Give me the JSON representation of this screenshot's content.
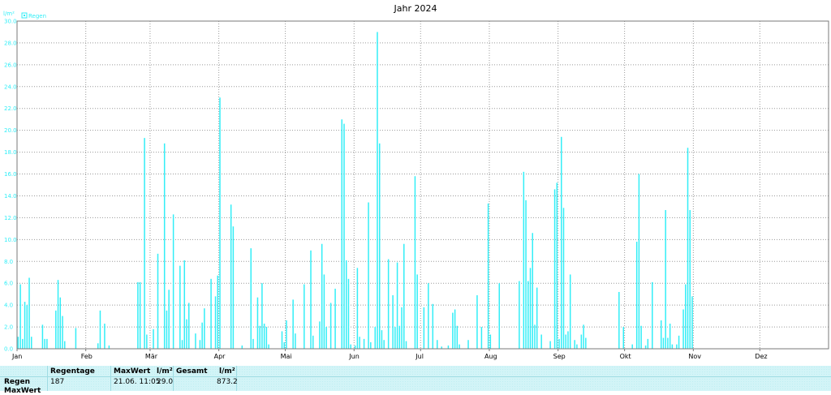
{
  "chart_data": {
    "type": "bar",
    "title": "Jahr 2024",
    "ylabel": "l/m²",
    "legend": [
      "Regen"
    ],
    "legend_position": "top-left",
    "series_color": "#33eef7",
    "grid": true,
    "ylim": [
      0,
      30
    ],
    "yticks": [
      "0.0",
      "2.0",
      "4.0",
      "6.0",
      "8.0",
      "10.0",
      "12.0",
      "14.0",
      "16.0",
      "18.0",
      "20.0",
      "22.0",
      "24.0",
      "26.0",
      "28.0",
      "30.0"
    ],
    "months": [
      "Jan",
      "Feb",
      "Mär",
      "Apr",
      "Mai",
      "Jun",
      "Jul",
      "Aug",
      "Sep",
      "Okt",
      "Nov",
      "Dez"
    ],
    "days_in_months": [
      31,
      29,
      31,
      30,
      31,
      30,
      31,
      31,
      30,
      31,
      30,
      31
    ],
    "x_unit": "day of year",
    "bars": [
      [
        1,
        1.1
      ],
      [
        2,
        5.9
      ],
      [
        3,
        0.9
      ],
      [
        4,
        4.3
      ],
      [
        5,
        4.0
      ],
      [
        6,
        6.5
      ],
      [
        7,
        1.1
      ],
      [
        12,
        2.2
      ],
      [
        13,
        0.9
      ],
      [
        14,
        0.9
      ],
      [
        18,
        3.5
      ],
      [
        19,
        6.3
      ],
      [
        20,
        4.7
      ],
      [
        21,
        3.0
      ],
      [
        22,
        0.7
      ],
      [
        27,
        1.9
      ],
      [
        37,
        0.5
      ],
      [
        38,
        3.5
      ],
      [
        40,
        2.3
      ],
      [
        42,
        0.3
      ],
      [
        55,
        6.1
      ],
      [
        56,
        6.1
      ],
      [
        58,
        19.3
      ],
      [
        59,
        1.3
      ],
      [
        62,
        1.8
      ],
      [
        64,
        8.7
      ],
      [
        67,
        18.8
      ],
      [
        68,
        3.5
      ],
      [
        69,
        5.4
      ],
      [
        71,
        12.3
      ],
      [
        74,
        7.6
      ],
      [
        75,
        0.8
      ],
      [
        76,
        8.1
      ],
      [
        77,
        2.7
      ],
      [
        78,
        4.2
      ],
      [
        81,
        1.4
      ],
      [
        83,
        0.8
      ],
      [
        84,
        2.4
      ],
      [
        85,
        3.7
      ],
      [
        88,
        6.4
      ],
      [
        90,
        4.8
      ],
      [
        91,
        6.7
      ],
      [
        92,
        23.0
      ],
      [
        97,
        13.2
      ],
      [
        98,
        11.2
      ],
      [
        102,
        0.3
      ],
      [
        106,
        9.2
      ],
      [
        107,
        0.9
      ],
      [
        109,
        4.7
      ],
      [
        110,
        2.1
      ],
      [
        111,
        6.0
      ],
      [
        112,
        2.3
      ],
      [
        113,
        2.0
      ],
      [
        114,
        0.4
      ],
      [
        120,
        1.6
      ],
      [
        121,
        0.6
      ],
      [
        122,
        2.6
      ],
      [
        125,
        4.5
      ],
      [
        126,
        1.4
      ],
      [
        130,
        5.9
      ],
      [
        133,
        9.0
      ],
      [
        134,
        1.2
      ],
      [
        137,
        2.5
      ],
      [
        138,
        9.6
      ],
      [
        139,
        6.8
      ],
      [
        140,
        2.0
      ],
      [
        142,
        4.2
      ],
      [
        144,
        5.5
      ],
      [
        147,
        21.0
      ],
      [
        148,
        20.6
      ],
      [
        149,
        8.1
      ],
      [
        150,
        6.4
      ],
      [
        151,
        0.4
      ],
      [
        153,
        0.3
      ],
      [
        154,
        7.4
      ],
      [
        155,
        1.1
      ],
      [
        157,
        0.9
      ],
      [
        159,
        13.4
      ],
      [
        160,
        0.6
      ],
      [
        162,
        2.0
      ],
      [
        163,
        29.0
      ],
      [
        164,
        18.8
      ],
      [
        165,
        1.7
      ],
      [
        166,
        0.8
      ],
      [
        168,
        8.2
      ],
      [
        170,
        4.9
      ],
      [
        171,
        2.0
      ],
      [
        172,
        7.9
      ],
      [
        173,
        2.1
      ],
      [
        174,
        3.8
      ],
      [
        175,
        9.6
      ],
      [
        176,
        0.7
      ],
      [
        180,
        15.8
      ],
      [
        181,
        6.8
      ],
      [
        184,
        3.8
      ],
      [
        186,
        6.0
      ],
      [
        188,
        4.1
      ],
      [
        190,
        0.8
      ],
      [
        192,
        0.2
      ],
      [
        195,
        0.3
      ],
      [
        197,
        3.3
      ],
      [
        198,
        3.6
      ],
      [
        199,
        2.1
      ],
      [
        200,
        0.4
      ],
      [
        204,
        0.8
      ],
      [
        208,
        4.9
      ],
      [
        210,
        2.0
      ],
      [
        213,
        13.3
      ],
      [
        214,
        1.3
      ],
      [
        218,
        6.0
      ],
      [
        227,
        6.2
      ],
      [
        229,
        16.2
      ],
      [
        230,
        13.6
      ],
      [
        231,
        6.2
      ],
      [
        232,
        7.4
      ],
      [
        233,
        10.6
      ],
      [
        234,
        2.2
      ],
      [
        235,
        5.6
      ],
      [
        237,
        1.3
      ],
      [
        241,
        0.7
      ],
      [
        243,
        14.6
      ],
      [
        244,
        15.2
      ],
      [
        245,
        0.9
      ],
      [
        246,
        19.4
      ],
      [
        247,
        12.9
      ],
      [
        248,
        1.3
      ],
      [
        249,
        1.6
      ],
      [
        250,
        6.8
      ],
      [
        252,
        0.8
      ],
      [
        253,
        0.4
      ],
      [
        255,
        1.3
      ],
      [
        256,
        2.2
      ],
      [
        257,
        1.0
      ],
      [
        272,
        5.2
      ],
      [
        274,
        2.0
      ],
      [
        278,
        0.4
      ],
      [
        280,
        9.8
      ],
      [
        281,
        16.0
      ],
      [
        282,
        2.1
      ],
      [
        284,
        0.3
      ],
      [
        285,
        0.9
      ],
      [
        287,
        6.1
      ],
      [
        291,
        2.6
      ],
      [
        292,
        1.0
      ],
      [
        293,
        12.7
      ],
      [
        294,
        1.0
      ],
      [
        295,
        2.3
      ],
      [
        296,
        0.4
      ],
      [
        298,
        0.4
      ],
      [
        299,
        1.2
      ],
      [
        301,
        3.6
      ],
      [
        302,
        5.9
      ],
      [
        303,
        18.4
      ],
      [
        304,
        12.7
      ],
      [
        305,
        4.8
      ]
    ]
  },
  "stats": {
    "row_label_regen": "Regen",
    "row_label_maxwert": "MaxWert",
    "regentage_header": "Regentage",
    "regentage_value": "187",
    "maxwert_header": "MaxWert",
    "maxwert_date": "21.06. 11:05",
    "maxwert_unit": "l/m²",
    "maxwert_value": "29.0",
    "gesamt_header": "Gesamt",
    "gesamt_unit": "l/m²",
    "gesamt_value": "873.2"
  }
}
